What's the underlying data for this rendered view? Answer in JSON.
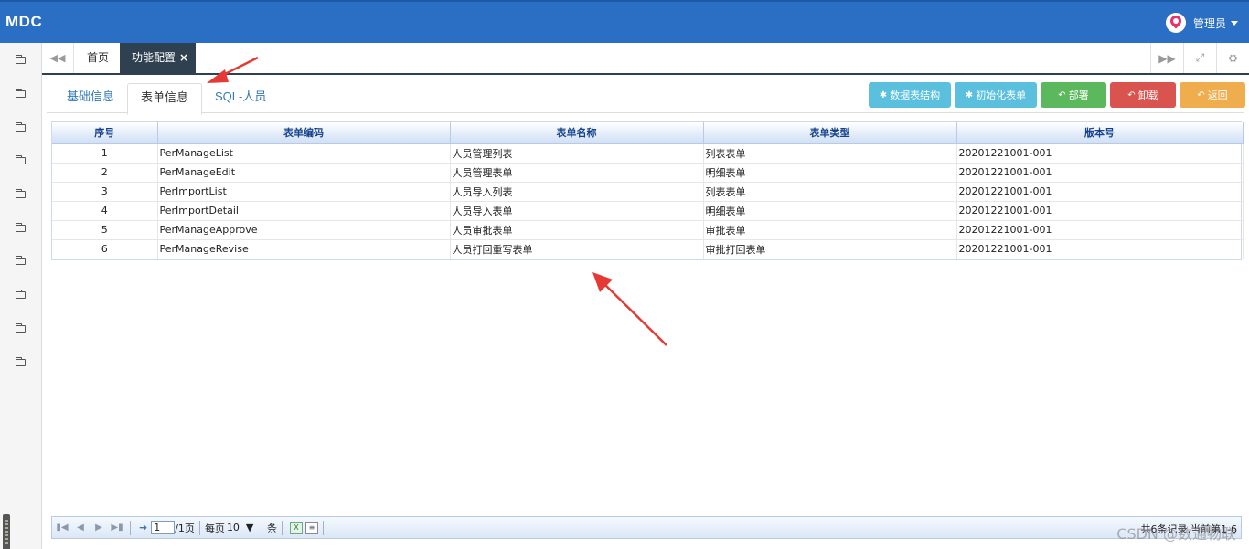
{
  "header": {
    "logo": "MDC",
    "user_name": "管理员",
    "bg_color": "#2a6fc4"
  },
  "sidebar": {
    "items": [
      "folder-icon",
      "folder-icon",
      "folder-icon",
      "folder-icon",
      "folder-icon",
      "folder-icon",
      "folder-icon",
      "folder-icon",
      "folder-icon",
      "folder-icon"
    ]
  },
  "tabbar": {
    "home": "首页",
    "active": "功能配置",
    "close": "×"
  },
  "subtabs": [
    "基础信息",
    "表单信息",
    "SQL-人员"
  ],
  "toolbar": {
    "buttons": [
      "数据表结构",
      "初始化表单",
      "部署",
      "卸载",
      "返回"
    ],
    "colors": {
      "info": "#5bc0de",
      "success": "#5cb85c",
      "danger": "#d9534f",
      "warning": "#f0ad4e"
    }
  },
  "grid": {
    "columns": [
      "序号",
      "表单编码",
      "表单名称",
      "表单类型",
      "版本号"
    ],
    "rows": [
      [
        "1",
        "PerManageList",
        "人员管理列表",
        "列表表单",
        "20201221001-001"
      ],
      [
        "2",
        "PerManageEdit",
        "人员管理表单",
        "明细表单",
        "20201221001-001"
      ],
      [
        "3",
        "PerImportList",
        "人员导入列表",
        "列表表单",
        "20201221001-001"
      ],
      [
        "4",
        "PerImportDetail",
        "人员导入表单",
        "明细表单",
        "20201221001-001"
      ],
      [
        "5",
        "PerManageApprove",
        "人员审批表单",
        "审批表单",
        "20201221001-001"
      ],
      [
        "6",
        "PerManageRevise",
        "人员打回重写表单",
        "审批打回表单",
        "20201221001-001"
      ]
    ]
  },
  "pager": {
    "page": "1",
    "page_total": "/1页",
    "per_page_label": "每页",
    "per_page": "10",
    "unit": "条",
    "total_text": "共6条记录,当前第1-6"
  },
  "watermark": "CSDN @数通物联"
}
